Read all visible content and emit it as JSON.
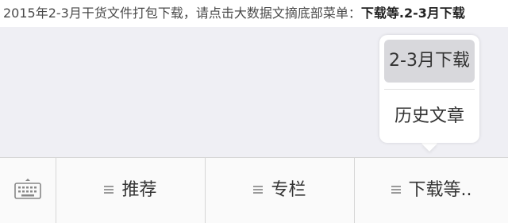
{
  "header": {
    "intro": "2015年2-3月干货文件打包下载，请点击大数据文摘底部菜单：",
    "emphasis": "下载等.2-3月下载"
  },
  "popup": {
    "items": [
      {
        "label": "2-3月下载"
      },
      {
        "label": "历史文章"
      }
    ]
  },
  "menu": {
    "keyboard_icon": "keyboard-icon",
    "items": [
      {
        "label": "推荐"
      },
      {
        "label": "专栏"
      },
      {
        "label": "下载等.."
      }
    ]
  },
  "colors": {
    "background": "#efeff4",
    "menu_bar": "#fafafa",
    "selected_item": "#d8d8dc"
  }
}
